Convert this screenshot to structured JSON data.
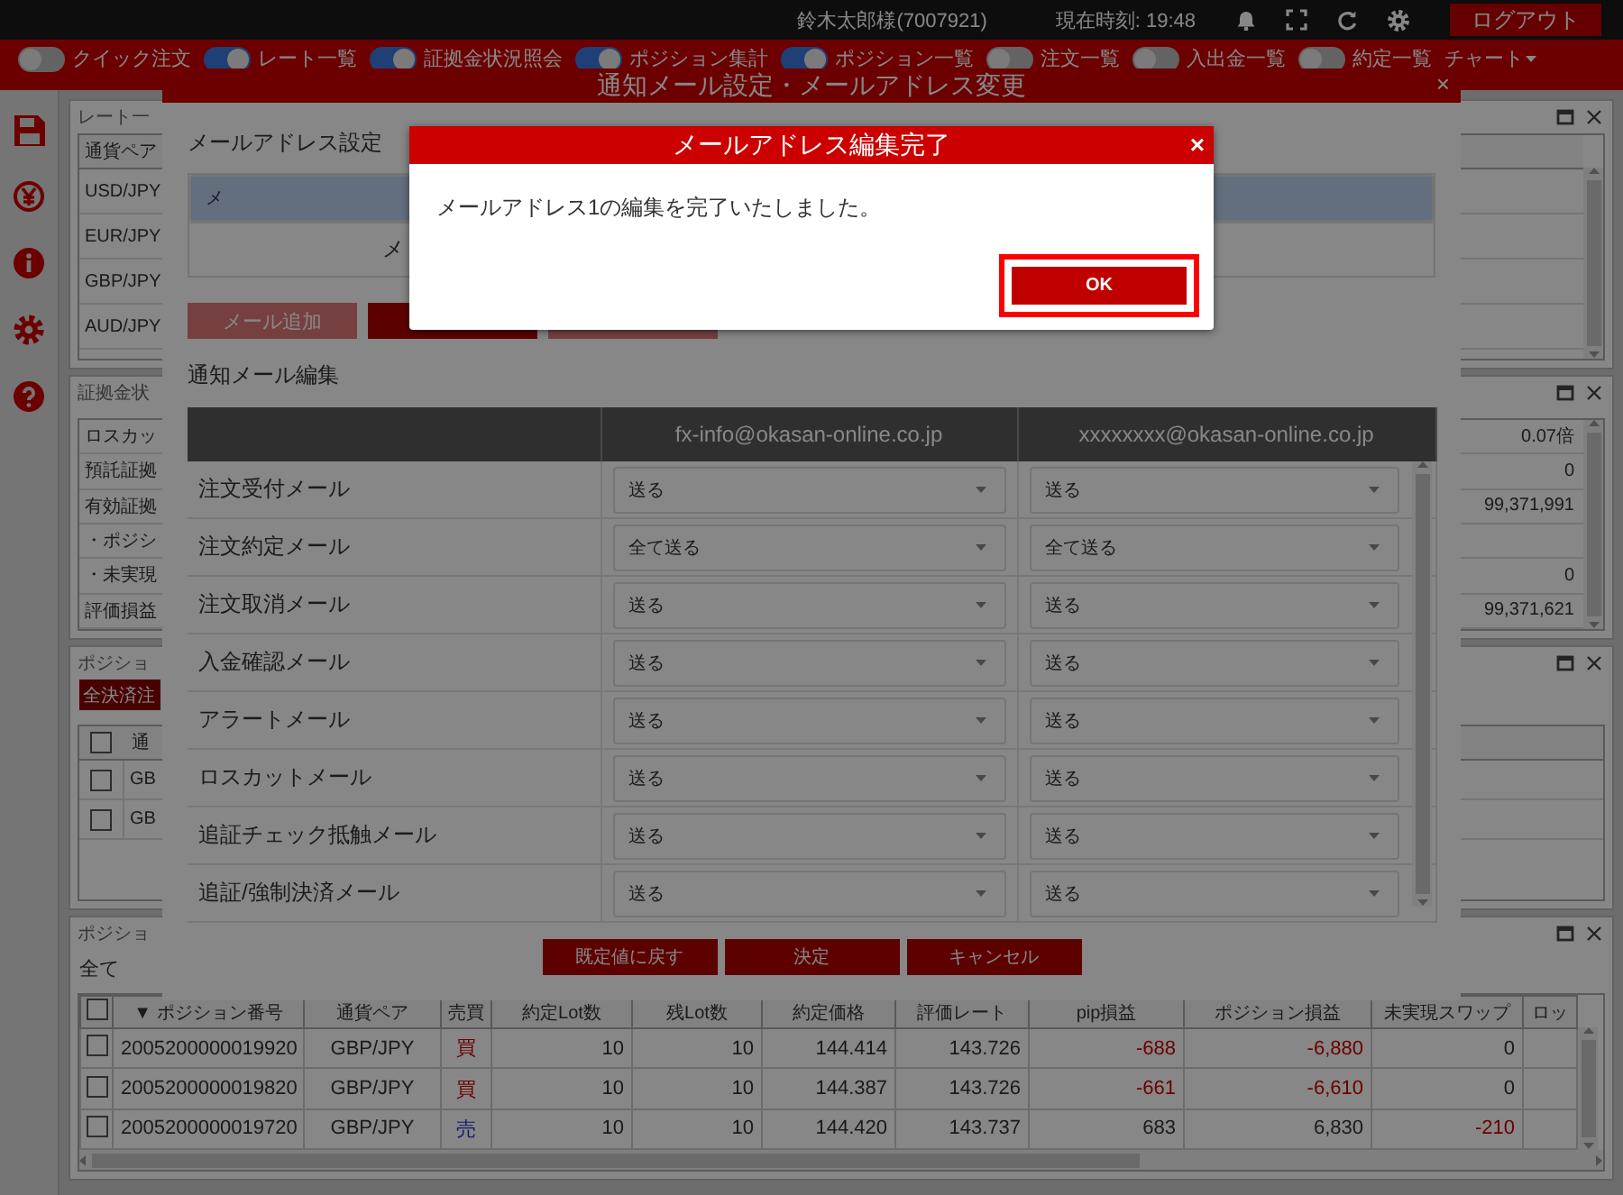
{
  "top_bar": {
    "user": "鈴木太郎様(7007921)",
    "clock": "現在時刻: 19:48",
    "logout": "ログアウト"
  },
  "nav": {
    "toggles": [
      {
        "label": "クイック注文",
        "on": false
      },
      {
        "label": "レート一覧",
        "on": true
      },
      {
        "label": "証拠金状況照会",
        "on": true
      },
      {
        "label": "ポジション集計",
        "on": true
      },
      {
        "label": "ポジション一覧",
        "on": true
      },
      {
        "label": "注文一覧",
        "on": false
      },
      {
        "label": "入出金一覧",
        "on": false
      },
      {
        "label": "約定一覧",
        "on": false
      }
    ],
    "menu": "チャート"
  },
  "panels": [
    {
      "kind": "rates",
      "title": "レート一",
      "column": "通貨ペア",
      "rows": [
        "USD/JPY",
        "EUR/JPY",
        "GBP/JPY",
        "AUD/JPY"
      ]
    },
    {
      "kind": "margin",
      "title": "証拠金状",
      "rows": [
        {
          "label": "ロスカッ",
          "value": "0.07倍"
        },
        {
          "label": "預託証拠",
          "value": "0"
        },
        {
          "label": "有効証拠",
          "value": "99,371,991"
        },
        {
          "label": "・ポジシ"
        },
        {
          "label": "・未実現",
          "value": "0"
        },
        {
          "label": "評価損益",
          "value": "99,371,621"
        }
      ]
    },
    {
      "kind": "summary",
      "title": "ポジショ",
      "button": "全決済注",
      "header_checked": false,
      "column": "通",
      "rows": [
        {
          "checked": false,
          "text": "GB"
        },
        {
          "checked": false,
          "text": "GB"
        }
      ]
    },
    {
      "kind": "positions",
      "title": "ポジショ",
      "filter": "全て",
      "header_checked": false,
      "columns": [
        "▼ ポジション番号",
        "通貨ペア",
        "売買",
        "約定Lot数",
        "残Lot数",
        "約定価格",
        "評価レート",
        "pip損益",
        "ポジション損益",
        "未実現スワップ",
        "ロッ"
      ],
      "rows": [
        {
          "checked": false,
          "id": "2005200000019920",
          "pair": "GBP/JPY",
          "side": {
            "label": "買",
            "kind": "buy"
          },
          "lots": "10",
          "remaining": "10",
          "price": "144.414",
          "rate": "143.726",
          "pip": {
            "text": "-688",
            "loss": true
          },
          "pl": {
            "text": "-6,880",
            "loss": true
          },
          "swap": {
            "text": "0",
            "loss": false
          }
        },
        {
          "checked": false,
          "id": "2005200000019820",
          "pair": "GBP/JPY",
          "side": {
            "label": "買",
            "kind": "buy"
          },
          "lots": "10",
          "remaining": "10",
          "price": "144.387",
          "rate": "143.726",
          "pip": {
            "text": "-661",
            "loss": true
          },
          "pl": {
            "text": "-6,610",
            "loss": true
          },
          "swap": {
            "text": "0",
            "loss": false
          }
        },
        {
          "checked": false,
          "id": "2005200000019720",
          "pair": "GBP/JPY",
          "side": {
            "label": "売",
            "kind": "sell"
          },
          "lots": "10",
          "remaining": "10",
          "price": "144.420",
          "rate": "143.737",
          "pip": {
            "text": "683",
            "loss": false
          },
          "pl": {
            "text": "6,830",
            "loss": false
          },
          "swap": {
            "text": "-210",
            "loss": true
          }
        }
      ]
    }
  ],
  "modal": {
    "title": "通知メール設定・メールアドレス変更",
    "close": "×",
    "address_heading": "メールアドレス設定",
    "addresses": [
      {
        "text": "メ",
        "selected": true
      },
      {
        "text": "メ",
        "selected": false
      }
    ],
    "address_buttons": [
      {
        "label": "メール追加",
        "disabled": true
      },
      {
        "disabled": false
      },
      {
        "disabled": true
      }
    ],
    "notify_heading": "通知メール編集",
    "columns": [
      "fx-info@okasan-online.co.jp",
      "xxxxxxxx@okasan-online.co.jp"
    ],
    "rows": [
      {
        "label": "注文受付メール",
        "settings": [
          "送る",
          "送る"
        ]
      },
      {
        "label": "注文約定メール",
        "settings": [
          "全て送る",
          "全て送る"
        ]
      },
      {
        "label": "注文取消メール",
        "settings": [
          "送る",
          "送る"
        ]
      },
      {
        "label": "入金確認メール",
        "settings": [
          "送る",
          "送る"
        ]
      },
      {
        "label": "アラートメール",
        "settings": [
          "送る",
          "送る"
        ]
      },
      {
        "label": "ロスカットメール",
        "settings": [
          "送る",
          "送る"
        ]
      },
      {
        "label": "追証チェック抵触メール",
        "settings": [
          "送る",
          "送る"
        ]
      },
      {
        "label": "追証/強制決済メール",
        "settings": [
          "送る",
          "送る"
        ]
      }
    ],
    "buttons": [
      "既定値に戻す",
      "決定",
      "キャンセル"
    ]
  },
  "dialog": {
    "title": "メールアドレス編集完了",
    "close": "×",
    "message": "メールアドレス1の編集を完了いたしました。",
    "ok": {
      "label": "OK",
      "focused": true
    }
  }
}
